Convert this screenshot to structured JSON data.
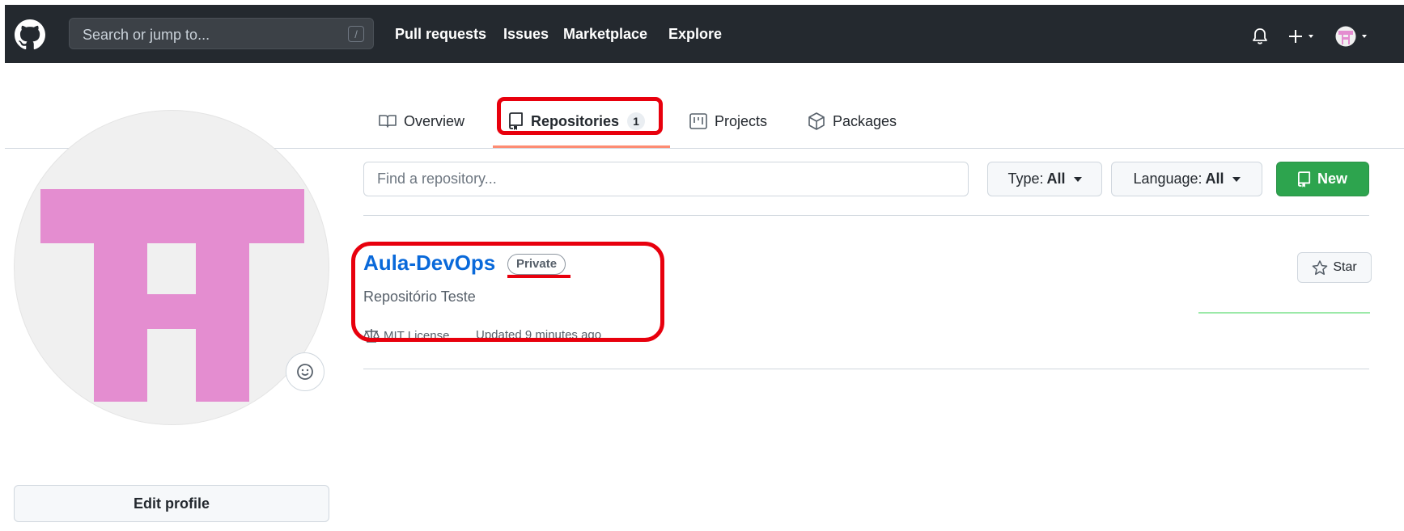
{
  "header": {
    "search_placeholder": "Search or jump to...",
    "search_shortcut": "/",
    "nav": [
      "Pull requests",
      "Issues",
      "Marketplace",
      "Explore"
    ]
  },
  "tabs": [
    {
      "label": "Overview",
      "icon": "book-icon"
    },
    {
      "label": "Repositories",
      "icon": "repo-icon",
      "count": "1",
      "selected": true
    },
    {
      "label": "Projects",
      "icon": "project-icon"
    },
    {
      "label": "Packages",
      "icon": "package-icon"
    }
  ],
  "profile": {
    "edit_label": "Edit profile"
  },
  "filters": {
    "find_placeholder": "Find a repository...",
    "type_label": "Type:",
    "type_value": "All",
    "language_label": "Language:",
    "language_value": "All",
    "new_label": "New"
  },
  "repo": {
    "name": "Aula-DevOps",
    "visibility": "Private",
    "description": "Repositório Teste",
    "license": "MIT License",
    "updated": "Updated 9 minutes ago",
    "star_label": "Star"
  },
  "colors": {
    "header_bg": "#24292f",
    "link_blue": "#0969da",
    "new_button_green": "#2da44e",
    "annotation_red": "#e8000d",
    "avatar_pink": "#e48dd0",
    "tab_underline": "#fd8c73"
  }
}
